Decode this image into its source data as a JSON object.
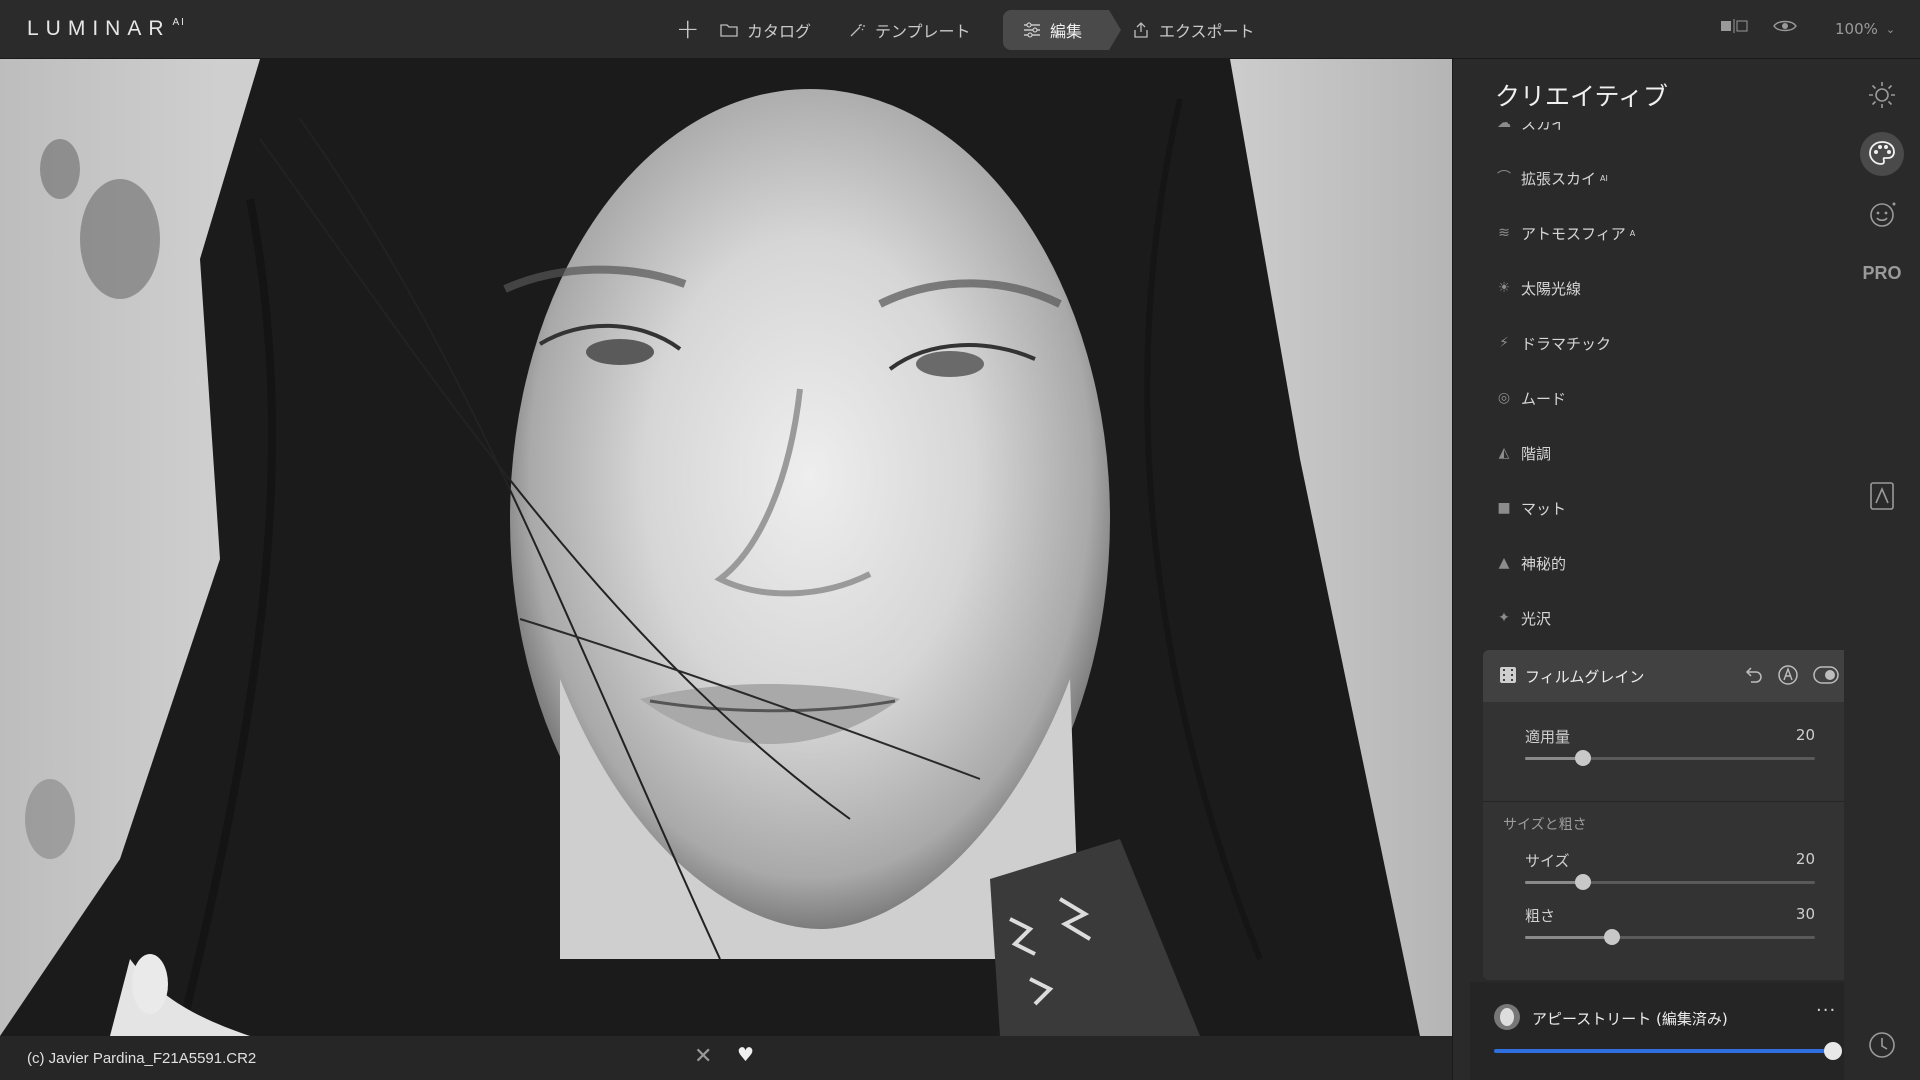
{
  "app": {
    "logo": "LUMINAR",
    "logo_sup": "AI"
  },
  "nav": {
    "add_label": "+",
    "items": [
      {
        "label": "カタログ",
        "icon": "folder-icon"
      },
      {
        "label": "テンプレート",
        "icon": "magic-wand-icon"
      },
      {
        "label": "編集",
        "icon": "sliders-icon",
        "active": true
      },
      {
        "label": "エクスポート",
        "icon": "share-icon"
      }
    ],
    "zoom": "100%"
  },
  "panel": {
    "title": "クリエイティブ",
    "cut_item": "スカイ",
    "tools": [
      {
        "label": "拡張スカイ",
        "sup": "AI",
        "icon": "sky-icon"
      },
      {
        "label": "アトモスフィア",
        "sup": "A",
        "icon": "waves-icon"
      },
      {
        "label": "太陽光線",
        "sup": "",
        "icon": "sun-icon"
      },
      {
        "label": "ドラマチック",
        "sup": "",
        "icon": "lightning-icon"
      },
      {
        "label": "ムード",
        "sup": "",
        "icon": "mood-icon"
      },
      {
        "label": "階調",
        "sup": "",
        "icon": "toning-icon"
      },
      {
        "label": "マット",
        "sup": "",
        "icon": "matte-icon"
      },
      {
        "label": "神秘的",
        "sup": "",
        "icon": "mystic-icon"
      },
      {
        "label": "光沢",
        "sup": "",
        "icon": "glow-icon"
      }
    ],
    "film_grain": {
      "title": "フィルムグレイン",
      "amount_label": "適用量",
      "amount": 20,
      "section": "サイズと粗さ",
      "size_label": "サイズ",
      "size": 20,
      "roughness_label": "粗さ",
      "roughness": 30
    }
  },
  "preset": {
    "name": "アピーストリート (編集済み)",
    "more": "···",
    "amount": 100
  },
  "bottom": {
    "filename": "(c) Javier Pardina_F21A5591.CR2"
  },
  "rail": {
    "pro_label": "PRO"
  }
}
